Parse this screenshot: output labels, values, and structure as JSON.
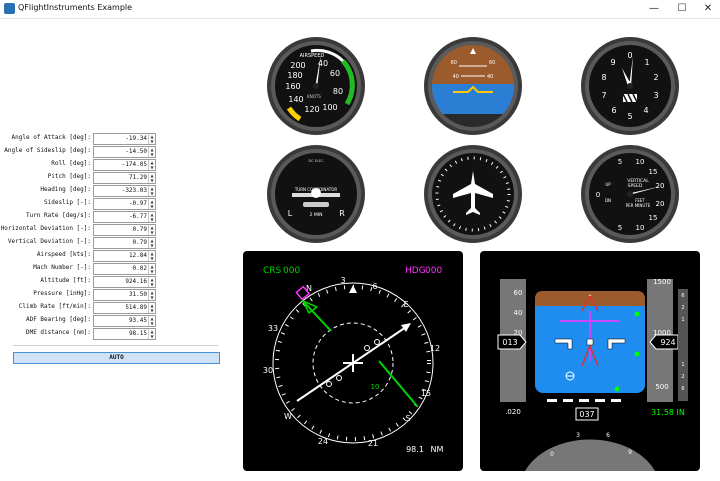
{
  "window": {
    "title": "QFlightInstruments Example",
    "minimize": "—",
    "maximize": "☐",
    "close": "✕"
  },
  "fields": [
    {
      "label": "Angle of Attack [deg]:",
      "value": "-19.34"
    },
    {
      "label": "Angle of Sideslip [deg]:",
      "value": "-14.50"
    },
    {
      "label": "Roll [deg]:",
      "value": "-174.05"
    },
    {
      "label": "Pitch [deg]:",
      "value": "71.29"
    },
    {
      "label": "Heading [deg]:",
      "value": "-323.03"
    },
    {
      "label": "Sideslip [-]:",
      "value": "-0.97"
    },
    {
      "label": "Turn Rate [deg/s]:",
      "value": "-6.77"
    },
    {
      "label": "Horizontal Deviation [-]:",
      "value": "0.79"
    },
    {
      "label": "Vertical Deviation [-]:",
      "value": "0.79"
    },
    {
      "label": "Airspeed [kts]:",
      "value": "12.84"
    },
    {
      "label": "Mach Number [-]:",
      "value": "0.02"
    },
    {
      "label": "Altitude [ft]:",
      "value": "924.16"
    },
    {
      "label": "Pressure [inHg]:",
      "value": "31.50"
    },
    {
      "label": "Climb Rate [ft/min]:",
      "value": "514.89"
    },
    {
      "label": "ADF Bearing [deg]:",
      "value": "93.45"
    },
    {
      "label": "DME distance [nm]:",
      "value": "98.15"
    }
  ],
  "auto_button": "AUTO",
  "airspeed": {
    "label": "AIRSPEED",
    "knots": "KNOTS",
    "ticks": [
      "40",
      "60",
      "80",
      "100",
      "120",
      "140",
      "160",
      "180",
      "200"
    ]
  },
  "attitude": {
    "labels": [
      "60",
      "60",
      "40",
      "40"
    ]
  },
  "altimeter": {
    "ticks": [
      "0",
      "1",
      "2",
      "3",
      "4",
      "5",
      "6",
      "7",
      "8",
      "9"
    ]
  },
  "turn": {
    "top": "DC ELEC",
    "label": "TURN COORDINATOR",
    "min": "2 MIN",
    "left": "L",
    "right": "R"
  },
  "vsi": {
    "line1": "VERTICAL",
    "line2": "SPEED",
    "up": "UP",
    "dn": "DN",
    "unit": "FEET",
    "per": "PER MINUTE",
    "ticks": [
      "5",
      "10",
      "15",
      "20",
      "5",
      "10",
      "15",
      "20",
      "0"
    ]
  },
  "nav": {
    "crs_label": "CRS",
    "crs_value": "000",
    "hdg_label": "HDG",
    "hdg_value": "000",
    "dme_value": "98.1",
    "dme_unit": "NM",
    "rose": [
      "3",
      "6",
      "E",
      "12",
      "15",
      "S",
      "21",
      "24",
      "W",
      "30",
      "33",
      "N"
    ],
    "bug": "10",
    "colors": {
      "course": "#00d400",
      "heading": "#ff33ff",
      "text": "#ffffff"
    }
  },
  "pfd": {
    "speed_ticks": [
      "60",
      "40",
      "20"
    ],
    "speed_value": "013",
    "mach": ".020",
    "alt_ticks": [
      "1500",
      "1000",
      "500"
    ],
    "alt_value": "924",
    "pressure": "31.58 IN",
    "heading_value": "037",
    "vsi_ticks": [
      "6",
      "2",
      "1",
      "1",
      "2",
      "6"
    ],
    "heading_scale": [
      "0",
      "3",
      "6",
      "9"
    ],
    "colors": {
      "sky": "#1f8cf0",
      "ground": "#9c5b2d",
      "bugs": "#ff33ff",
      "text": "#00ff00"
    }
  }
}
